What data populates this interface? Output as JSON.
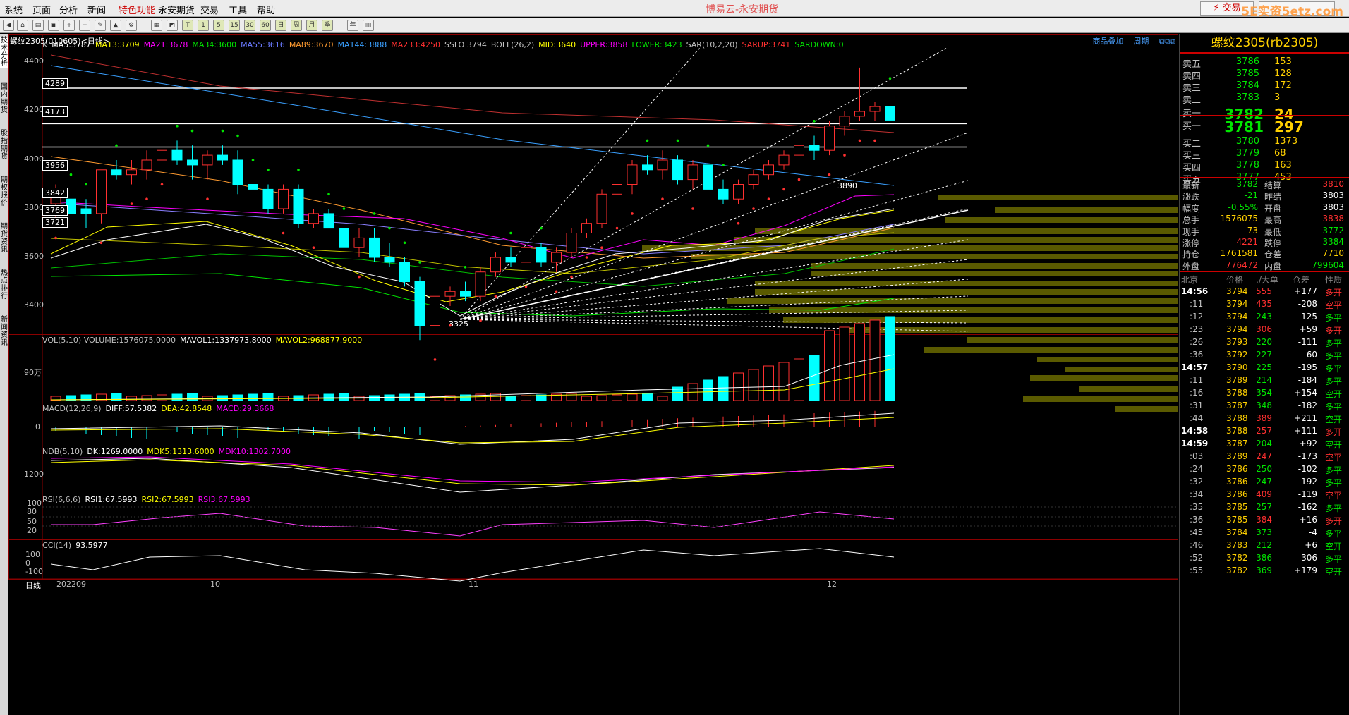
{
  "menu": [
    "系统",
    "页面",
    "分析",
    "新闻",
    "特色功能",
    "永安期货",
    "交易",
    "工具",
    "帮助"
  ],
  "app_title": "博易云-永安期货",
  "trade_button": "⚡ 交易",
  "watermark": "5E实资5etz.com",
  "toolbar_icons": [
    "back-icon",
    "home-icon",
    "open-icon",
    "window-icon",
    "zoom-in-icon",
    "zoom-out-icon",
    "pen-icon",
    "lock-icon",
    "tools-icon",
    "table-icon",
    "chart-icon",
    "tick-icon",
    "min1-icon",
    "min5-icon",
    "min15-icon",
    "min30-icon",
    "min60-icon",
    "day-icon",
    "week-icon",
    "month-icon",
    "quarter-icon",
    "year-icon",
    "calc-icon"
  ],
  "sidebar_tabs": [
    "技术分析",
    "国内期货",
    "股指期货",
    "期权报价",
    "期货资讯",
    "热点排行",
    "新闻资讯"
  ],
  "chart": {
    "title": "螺纹2305(010605)<日线>",
    "links": [
      "商品叠加",
      "周期"
    ],
    "main_indicators": [
      {
        "text": "K",
        "color": "#c0c0c0"
      },
      {
        "text": "MA5:3787",
        "color": "#ffffff"
      },
      {
        "text": "MA13:3709",
        "color": "#ffff00"
      },
      {
        "text": "MA21:3678",
        "color": "#ff00ff"
      },
      {
        "text": "MA34:3600",
        "color": "#00e600"
      },
      {
        "text": "MA55:3616",
        "color": "#6a7aff"
      },
      {
        "text": "MA89:3670",
        "color": "#ff9b30"
      },
      {
        "text": "MA144:3888",
        "color": "#3aa0ff"
      },
      {
        "text": "MA233:4250",
        "color": "#ff3030"
      },
      {
        "text": "SSLO 3794",
        "color": "#c0c0c0"
      },
      {
        "text": "BOLL(26,2)",
        "color": "#c0c0c0"
      },
      {
        "text": "MID:3640",
        "color": "#ffff00"
      },
      {
        "text": "UPPER:3858",
        "color": "#ff00ff"
      },
      {
        "text": "LOWER:3423",
        "color": "#00e600"
      },
      {
        "text": "SAR(10,2,20)",
        "color": "#c0c0c0"
      },
      {
        "text": "SARUP:3741",
        "color": "#ff3030"
      },
      {
        "text": "SARDOWN:0",
        "color": "#00e600"
      }
    ],
    "price_axis": [
      "4400",
      "4200",
      "4000",
      "3800",
      "3600",
      "3400"
    ],
    "price_boxes": [
      "4289",
      "4173",
      "3956",
      "3842",
      "3769",
      "3721"
    ],
    "high_label": "3890",
    "low_label": "3325",
    "vol_header": [
      {
        "text": "VOL(5,10) VOLUME:1576075.0000",
        "color": "#c0c0c0"
      },
      {
        "text": "MAVOL1:1337973.8000",
        "color": "#ffffff"
      },
      {
        "text": "MAVOL2:968877.9000",
        "color": "#ffff00"
      }
    ],
    "vol_axis": "90万",
    "macd_header": [
      {
        "text": "MACD(12,26,9)",
        "color": "#c0c0c0"
      },
      {
        "text": "DIFF:57.5382",
        "color": "#ffffff"
      },
      {
        "text": "DEA:42.8548",
        "color": "#ffff00"
      },
      {
        "text": "MACD:29.3668",
        "color": "#ff00ff"
      }
    ],
    "macd_axis": "0",
    "ndb_header": [
      {
        "text": "NDB(5,10)",
        "color": "#c0c0c0"
      },
      {
        "text": "DK:1269.0000",
        "color": "#ffffff"
      },
      {
        "text": "MDK5:1313.6000",
        "color": "#ffff00"
      },
      {
        "text": "MDK10:1302.7000",
        "color": "#ff00ff"
      }
    ],
    "ndb_axis": "1200",
    "rsi_header": [
      {
        "text": "RSI(6,6,6)",
        "color": "#c0c0c0"
      },
      {
        "text": "RSI1:67.5993",
        "color": "#ffffff"
      },
      {
        "text": "RSI2:67.5993",
        "color": "#ffff00"
      },
      {
        "text": "RSI3:67.5993",
        "color": "#ff00ff"
      }
    ],
    "rsi_axis": [
      "100",
      "80",
      "50",
      "20"
    ],
    "cci_header": [
      {
        "text": "CCI(14)",
        "color": "#c0c0c0"
      },
      {
        "text": "93.5977",
        "color": "#ffffff"
      }
    ],
    "cci_axis": [
      "100",
      "0",
      "-100"
    ],
    "date_axis": [
      "日线",
      "202209",
      "10",
      "11",
      "12"
    ]
  },
  "quote": {
    "title": "螺纹2305(rb2305)",
    "asks": [
      {
        "label": "卖五",
        "price": "3786",
        "vol": "153"
      },
      {
        "label": "卖四",
        "price": "3785",
        "vol": "128"
      },
      {
        "label": "卖三",
        "price": "3784",
        "vol": "172"
      },
      {
        "label": "卖二",
        "price": "3783",
        "vol": "3"
      },
      {
        "label": "卖一",
        "price": "3782",
        "vol": "24"
      }
    ],
    "bids": [
      {
        "label": "买一",
        "price": "3781",
        "vol": "297"
      },
      {
        "label": "买二",
        "price": "3780",
        "vol": "1373"
      },
      {
        "label": "买三",
        "price": "3779",
        "vol": "68"
      },
      {
        "label": "买四",
        "price": "3778",
        "vol": "163"
      },
      {
        "label": "买五",
        "price": "3777",
        "vol": "453"
      }
    ],
    "stats": [
      {
        "l1": "最新",
        "v1": "3782",
        "c1": "green",
        "l2": "结算",
        "v2": "3810",
        "c2": "red"
      },
      {
        "l1": "涨跌",
        "v1": "-21",
        "c1": "green",
        "l2": "昨结",
        "v2": "3803",
        "c2": "white"
      },
      {
        "l1": "幅度",
        "v1": "-0.55%",
        "c1": "green",
        "l2": "开盘",
        "v2": "3803",
        "c2": "white"
      },
      {
        "l1": "总手",
        "v1": "1576075",
        "c1": "yellow",
        "l2": "最高",
        "v2": "3838",
        "c2": "red"
      },
      {
        "l1": "现手",
        "v1": "73",
        "c1": "yellow",
        "l2": "最低",
        "v2": "3772",
        "c2": "green"
      },
      {
        "l1": "涨停",
        "v1": "4221",
        "c1": "red",
        "l2": "跌停",
        "v2": "3384",
        "c2": "green"
      },
      {
        "l1": "持仓",
        "v1": "1761581",
        "c1": "yellow",
        "l2": "仓差",
        "v2": "7710",
        "c2": "yellow"
      },
      {
        "l1": "外盘",
        "v1": "776472",
        "c1": "red",
        "l2": "内盘",
        "v2": "799604",
        "c2": "green"
      }
    ],
    "tick_header": [
      "北京",
      "价格",
      "./大单",
      "仓差",
      "性质"
    ],
    "ticks": [
      {
        "t": "14:56",
        "p": "3794",
        "pc": "yellow",
        "v": "555",
        "vc": "red",
        "d": "+177",
        "n": "多开",
        "nc": "red"
      },
      {
        "t": ":11",
        "p": "3794",
        "pc": "yellow",
        "v": "435",
        "vc": "red",
        "d": "-208",
        "n": "空平",
        "nc": "red"
      },
      {
        "t": ":12",
        "p": "3794",
        "pc": "yellow",
        "v": "243",
        "vc": "green",
        "d": "-125",
        "n": "多平",
        "nc": "green"
      },
      {
        "t": ":23",
        "p": "3794",
        "pc": "yellow",
        "v": "306",
        "vc": "red",
        "d": "+59",
        "n": "多开",
        "nc": "red"
      },
      {
        "t": ":26",
        "p": "3793",
        "pc": "yellow",
        "v": "220",
        "vc": "green",
        "d": "-111",
        "n": "多平",
        "nc": "green"
      },
      {
        "t": ":36",
        "p": "3792",
        "pc": "yellow",
        "v": "227",
        "vc": "green",
        "d": "-60",
        "n": "多平",
        "nc": "green"
      },
      {
        "t": "14:57",
        "p": "3790",
        "pc": "yellow",
        "v": "225",
        "vc": "green",
        "d": "-195",
        "n": "多平",
        "nc": "green"
      },
      {
        "t": ":11",
        "p": "3789",
        "pc": "yellow",
        "v": "214",
        "vc": "green",
        "d": "-184",
        "n": "多平",
        "nc": "green"
      },
      {
        "t": ":16",
        "p": "3788",
        "pc": "yellow",
        "v": "354",
        "vc": "green",
        "d": "+154",
        "n": "空开",
        "nc": "green"
      },
      {
        "t": ":31",
        "p": "3787",
        "pc": "yellow",
        "v": "348",
        "vc": "green",
        "d": "-182",
        "n": "多平",
        "nc": "green"
      },
      {
        "t": ":44",
        "p": "3788",
        "pc": "yellow",
        "v": "389",
        "vc": "red",
        "d": "+211",
        "n": "空开",
        "nc": "green"
      },
      {
        "t": "14:58",
        "p": "3788",
        "pc": "yellow",
        "v": "257",
        "vc": "red",
        "d": "+111",
        "n": "多开",
        "nc": "red"
      },
      {
        "t": "14:59",
        "p": "3787",
        "pc": "yellow",
        "v": "204",
        "vc": "green",
        "d": "+92",
        "n": "空开",
        "nc": "green"
      },
      {
        "t": ":03",
        "p": "3789",
        "pc": "yellow",
        "v": "247",
        "vc": "red",
        "d": "-173",
        "n": "空平",
        "nc": "red"
      },
      {
        "t": ":24",
        "p": "3786",
        "pc": "yellow",
        "v": "250",
        "vc": "green",
        "d": "-102",
        "n": "多平",
        "nc": "green"
      },
      {
        "t": ":32",
        "p": "3786",
        "pc": "yellow",
        "v": "247",
        "vc": "green",
        "d": "-192",
        "n": "多平",
        "nc": "green"
      },
      {
        "t": ":34",
        "p": "3786",
        "pc": "yellow",
        "v": "409",
        "vc": "red",
        "d": "-119",
        "n": "空平",
        "nc": "red"
      },
      {
        "t": ":35",
        "p": "3785",
        "pc": "yellow",
        "v": "257",
        "vc": "green",
        "d": "-162",
        "n": "多平",
        "nc": "green"
      },
      {
        "t": ":36",
        "p": "3785",
        "pc": "yellow",
        "v": "384",
        "vc": "red",
        "d": "+16",
        "n": "多开",
        "nc": "red"
      },
      {
        "t": ":45",
        "p": "3784",
        "pc": "yellow",
        "v": "373",
        "vc": "green",
        "d": "-4",
        "n": "多平",
        "nc": "green"
      },
      {
        "t": ":46",
        "p": "3783",
        "pc": "yellow",
        "v": "212",
        "vc": "green",
        "d": "+6",
        "n": "空开",
        "nc": "green"
      },
      {
        "t": ":52",
        "p": "3782",
        "pc": "yellow",
        "v": "386",
        "vc": "green",
        "d": "-306",
        "n": "多平",
        "nc": "green"
      },
      {
        "t": ":55",
        "p": "3782",
        "pc": "yellow",
        "v": "369",
        "vc": "green",
        "d": "+179",
        "n": "空开",
        "nc": "green"
      }
    ]
  }
}
